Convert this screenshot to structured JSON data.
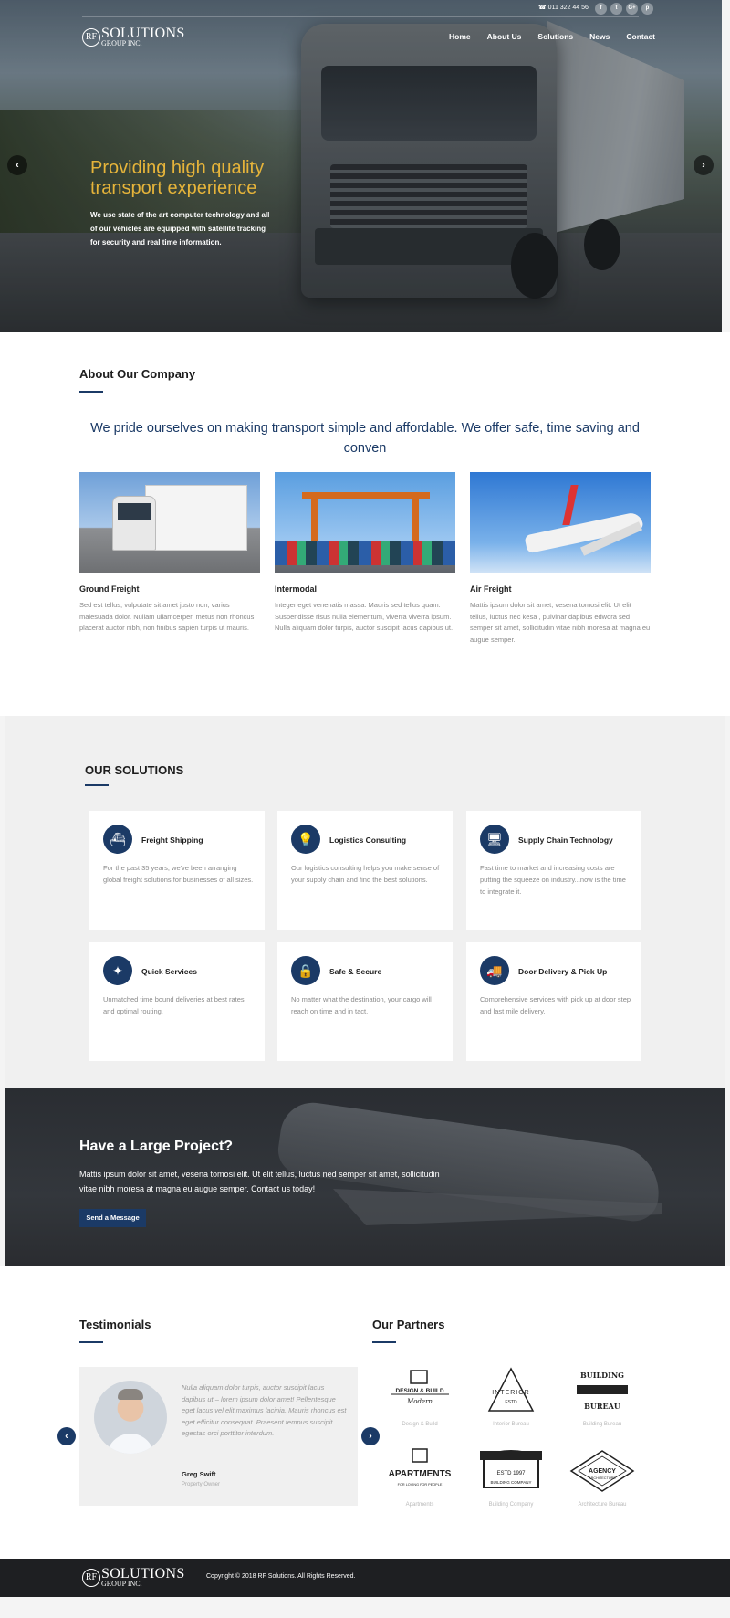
{
  "header": {
    "phone": "011 322 44 56",
    "socials": [
      "f",
      "t",
      "G+",
      "p"
    ],
    "logo_rf": "RF",
    "logo_main": "SOLUTIONS",
    "logo_sub": "GROUP INC.",
    "nav": [
      "Home",
      "About Us",
      "Solutions",
      "News",
      "Contact"
    ]
  },
  "hero": {
    "title": "Providing high quality transport experience",
    "text": "We use state of the art computer technology and all of our vehicles are equipped with satellite tracking for security and real time information.",
    "prev": "‹",
    "next": "›"
  },
  "about": {
    "title": "About Our Company",
    "lead": "We pride ourselves on making transport simple and affordable. We offer safe, time saving and conven",
    "cards": [
      {
        "title": "Ground Freight",
        "text": "Sed est tellus, vulputate sit amet justo non, varius malesuada dolor. Nullam ullamcerper, metus non rhoncus placerat auctor nibh, non finibus sapien turpis ut mauris."
      },
      {
        "title": "Intermodal",
        "text": "Integer eget venenatis massa. Mauris sed tellus quam. Suspendisse risus nulla elementum, viverra viverra ipsum. Nulla aliquam dolor turpis, auctor suscipit lacus dapibus ut."
      },
      {
        "title": "Air Freight",
        "text": "Mattis ipsum dolor sit amet, vesena tomosi elit. Ut elit tellus, luctus nec kesa , pulvinar dapibus edwora sed semper sit amet, sollicitudin vitae nibh moresa at magna eu augue semper."
      }
    ]
  },
  "solutions": {
    "title": "OUR SOLUTIONS",
    "items": [
      {
        "icon": "ship-icon",
        "glyph": "⛴",
        "title": "Freight Shipping",
        "text": "For the past 35 years, we've been arranging global freight solutions for businesses of all sizes."
      },
      {
        "icon": "lightbulb-icon",
        "glyph": "💡",
        "title": "Logistics Consulting",
        "text": "Our logistics consulting helps you make sense of your supply chain and find the best solutions."
      },
      {
        "icon": "monitor-icon",
        "glyph": "🖥",
        "title": "Supply Chain Technology",
        "text": "Fast time to market and increasing costs are putting the squeeze on industry...now is the time to integrate it."
      },
      {
        "icon": "magic-wand-icon",
        "glyph": "✦",
        "title": "Quick Services",
        "text": "Unmatched time bound deliveries at best rates and optimal routing."
      },
      {
        "icon": "lock-icon",
        "glyph": "🔒",
        "title": "Safe & Secure",
        "text": "No matter what the destination, your cargo will reach on time and in tact."
      },
      {
        "icon": "truck-icon",
        "glyph": "🚚",
        "title": "Door Delivery & Pick Up",
        "text": "Comprehensive services with pick up at door step and last mile delivery."
      }
    ]
  },
  "cta": {
    "title": "Have a Large Project?",
    "text": "Mattis ipsum dolor sit amet, vesena tomosi elit. Ut elit tellus, luctus ned semper sit amet, sollicitudin vitae nibh moresa at magna eu augue semper. Contact us today!",
    "button": "Send a Message"
  },
  "testimonials": {
    "title": "Testimonials",
    "quote": "Nulla aliquam dolor turpis, auctor suscipit lacus dapibus ut – lorem ipsum dolor amet! Pellentesque eget lacus vel elit maximus lacinia. Mauris rhoncus est eget efficitur consequat. Praesent tempus suscipit egestas orci porttitor interdum.",
    "name": "Greg Swift",
    "role": "Property Owner",
    "prev": "‹",
    "next": "›"
  },
  "partners": {
    "title": "Our Partners",
    "items": [
      {
        "name": "Design & Build",
        "logo_line1": "DESIGN & BUILD",
        "logo_line2": "Modern"
      },
      {
        "name": "Interior Bureau",
        "logo_line1": "INTERIOR",
        "logo_line2": "ESTD"
      },
      {
        "name": "Building Bureau",
        "logo_line1": "BUILDING",
        "logo_line2": "BUREAU"
      },
      {
        "name": "Apartments",
        "logo_line1": "APARTMENTS",
        "logo_line2": "FOR LOVING FOR PEOPLE"
      },
      {
        "name": "Building Company",
        "logo_line1": "ESTD 1997",
        "logo_line2": "BUILDING COMPANY"
      },
      {
        "name": "Architecture Bureau",
        "logo_line1": "AGENCY",
        "logo_line2": "ARCHITECTURE"
      }
    ]
  },
  "footer": {
    "copyright": "Copyright © 2018 RF Solutions. All Rights Reserved."
  },
  "colors": {
    "brand_navy": "#1b3a66",
    "hero_title": "#e6b43a",
    "footer_bg": "#1e1f22"
  }
}
